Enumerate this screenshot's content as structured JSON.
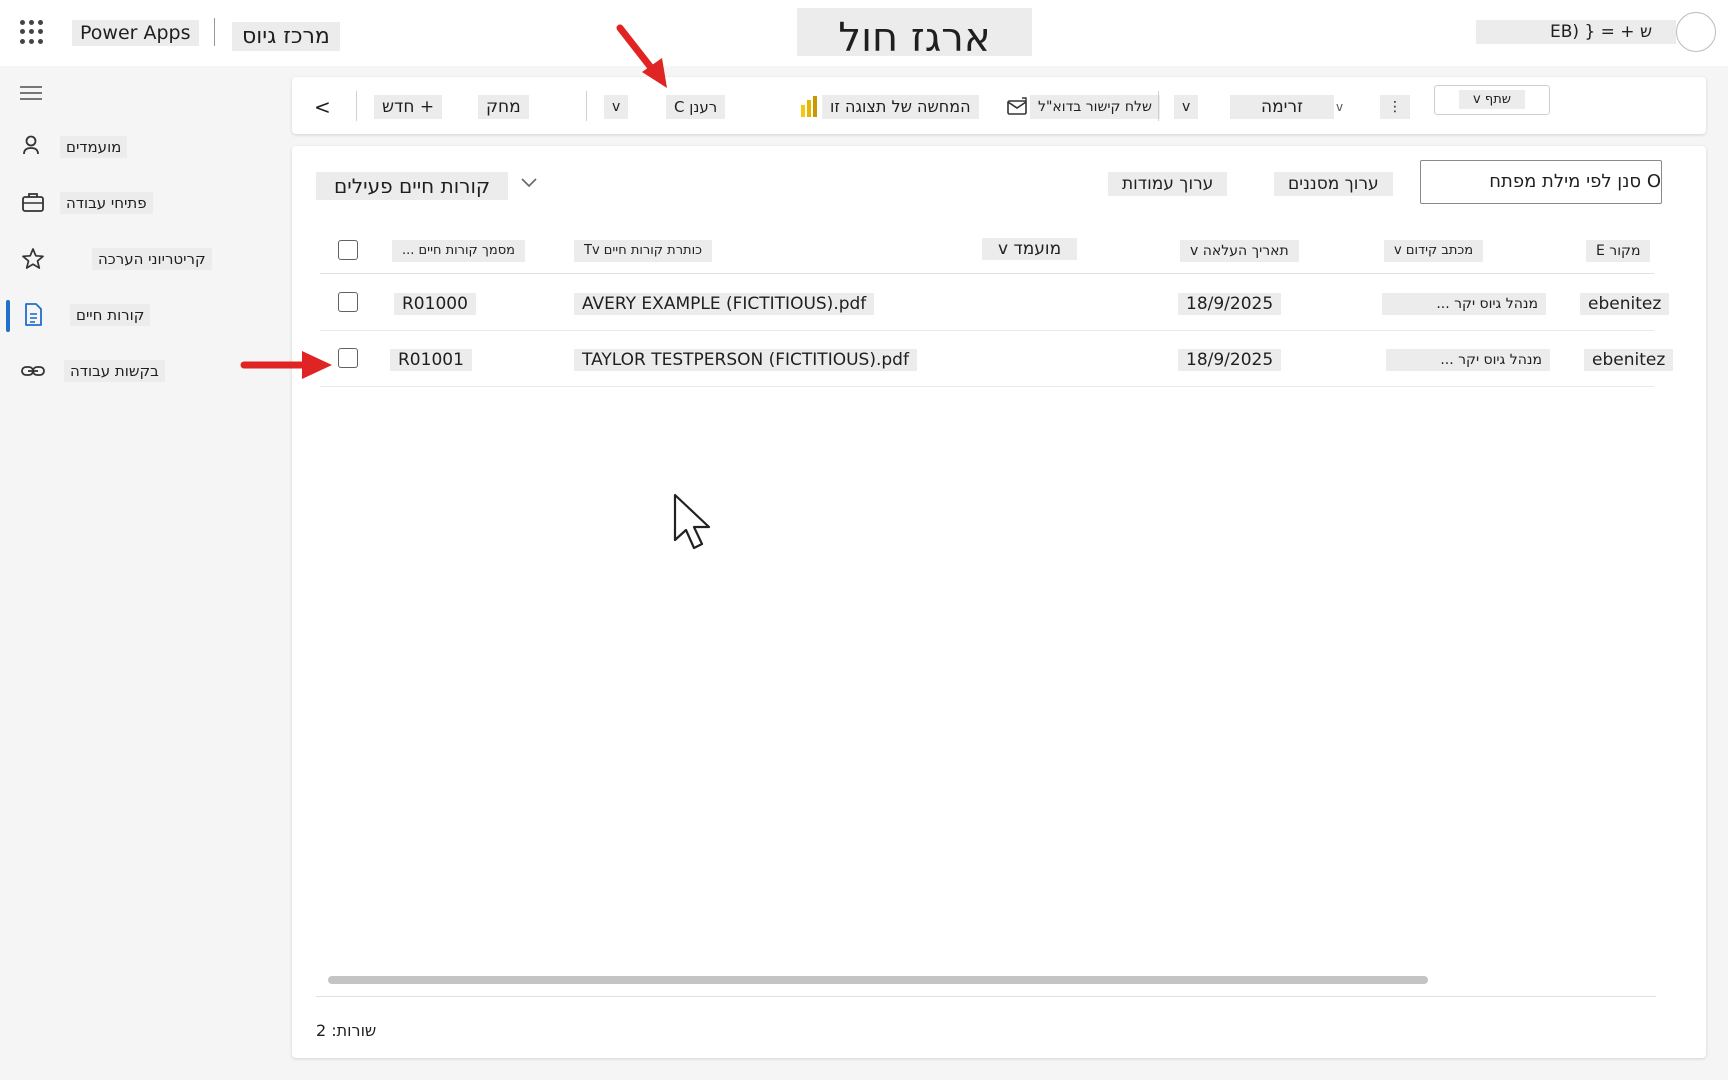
{
  "app": {
    "name": "Power Apps",
    "title": "מרכז גיוס",
    "page_heading": "ארגז חול",
    "user": "EB) } = + ש"
  },
  "sidebar": {
    "items": [
      {
        "label": "מועמדים",
        "icon": "people-icon",
        "active": false
      },
      {
        "label": "פתיחי עבודה",
        "icon": "briefcase-icon",
        "active": false
      },
      {
        "label": "קריטריוני הערכה",
        "icon": "star-icon",
        "active": false
      },
      {
        "label": "קורות חיים",
        "icon": "document-icon",
        "active": true
      },
      {
        "label": "בקשות עבודה",
        "icon": "link-icon",
        "active": false
      }
    ]
  },
  "commandbar": {
    "back": "<",
    "new": "+ חדש",
    "delete": "מחק",
    "refresh": "רענן C",
    "refresh_chevron": "v",
    "visualize": "המחשה של תצוגה זו",
    "email_link": "שלח קישור בדוא\"ל",
    "email_chevron": "v",
    "flow": "זרימה",
    "flow_chevron": "v",
    "more": "⋮",
    "share": "שתף v"
  },
  "view": {
    "name": "קורות חיים פעילים",
    "edit_columns": "ערוך עמודות",
    "edit_filters": "ערוך מסננים",
    "search_placeholder": "O סנן לפי מילת מפתח"
  },
  "grid": {
    "columns": [
      {
        "label": "מסמך קורות חיים ...",
        "key": "number"
      },
      {
        "label": "כותרת קורות חיים Tv",
        "key": "file"
      },
      {
        "label": "מועמד v",
        "key": "candidate"
      },
      {
        "label": "תאריך העלאה v",
        "key": "date"
      },
      {
        "label": "מכתב קידום v",
        "key": "letter"
      },
      {
        "label": "מקור E",
        "key": "owner"
      }
    ],
    "rows": [
      {
        "number": "R01000",
        "file": "AVERY EXAMPLE (FICTITIOUS).pdf",
        "candidate": "",
        "date": "18/9/2025",
        "letter": "מנהל גיוס יקר ...",
        "owner": "ebenitez"
      },
      {
        "number": "R01001",
        "file": "TAYLOR TESTPERSON (FICTITIOUS).pdf",
        "candidate": "",
        "date": "18/9/2025",
        "letter": "מנהל גיוס יקר ...",
        "owner": "ebenitez"
      }
    ]
  },
  "footer": {
    "rows_count": "שורות: 2"
  },
  "colors": {
    "accent": "#1f6fcc",
    "annotation_arrow": "#e02424",
    "label_highlight": "#ececec",
    "powerbi_icon": "#f2c811"
  }
}
